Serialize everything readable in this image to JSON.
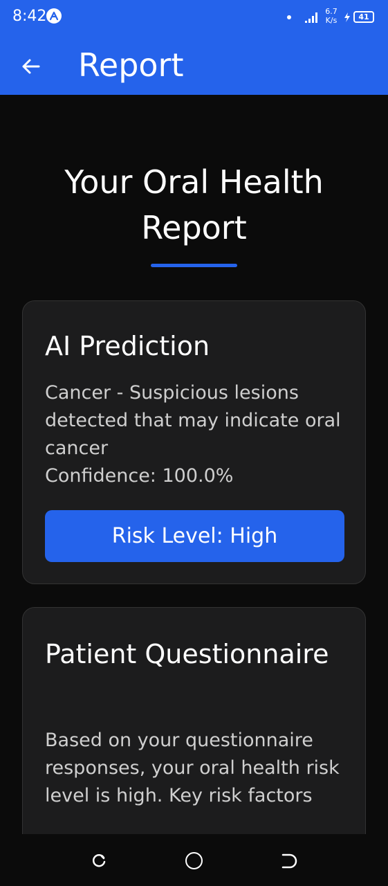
{
  "status_bar": {
    "time": "8:42",
    "network_speed_value": "6.7",
    "network_speed_unit": "K/s",
    "battery_level": "41"
  },
  "app_bar": {
    "title": "Report",
    "back_icon": "arrow-left-icon"
  },
  "page": {
    "heading": "Your Oral Health Report"
  },
  "ai_prediction": {
    "title": "AI Prediction",
    "description": "Cancer - Suspicious lesions detected that may indicate oral cancer",
    "confidence": "Confidence: 100.0%",
    "risk_label": "Risk Level: High"
  },
  "questionnaire": {
    "title": "Patient Questionnaire",
    "summary": "Based on your questionnaire responses, your oral health risk level is high. Key risk factors"
  },
  "nav_bar": {
    "icons": [
      "recents-icon",
      "home-icon",
      "back-icon"
    ]
  },
  "colors": {
    "accent": "#2563eb",
    "background": "#0b0b0b",
    "card": "#1c1c1d",
    "body_text": "#cfcfcf"
  }
}
